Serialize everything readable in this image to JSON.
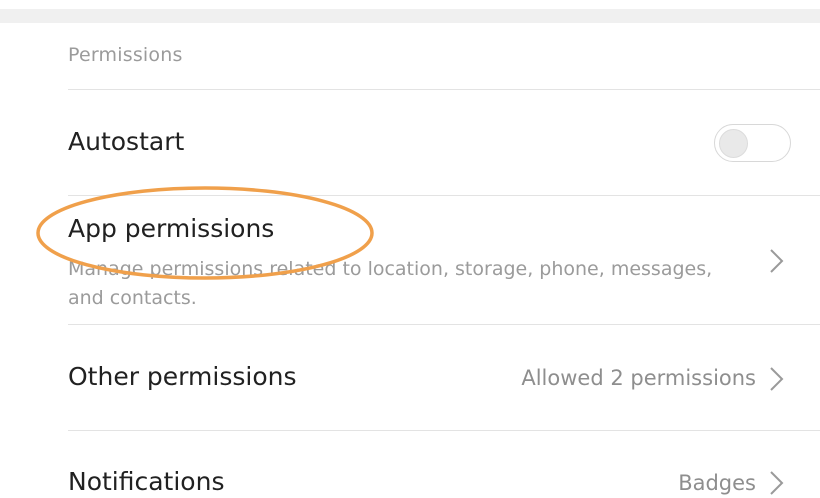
{
  "section_header": "Permissions",
  "rows": {
    "autostart": {
      "title": "Autostart",
      "toggle_state": "off"
    },
    "app_permissions": {
      "title": "App permissions",
      "description": "Manage permissions related to location, storage, phone, messages, and contacts."
    },
    "other_permissions": {
      "title": "Other permissions",
      "value": "Allowed 2 permissions"
    },
    "notifications": {
      "title": "Notifications",
      "value": "Badges"
    }
  },
  "colors": {
    "highlight_ring": "#f0a04b",
    "text_primary": "#212121",
    "text_secondary": "#9b9b9b",
    "divider": "#e3e3e3"
  },
  "icons": {
    "chevron": "chevron-right-icon"
  }
}
